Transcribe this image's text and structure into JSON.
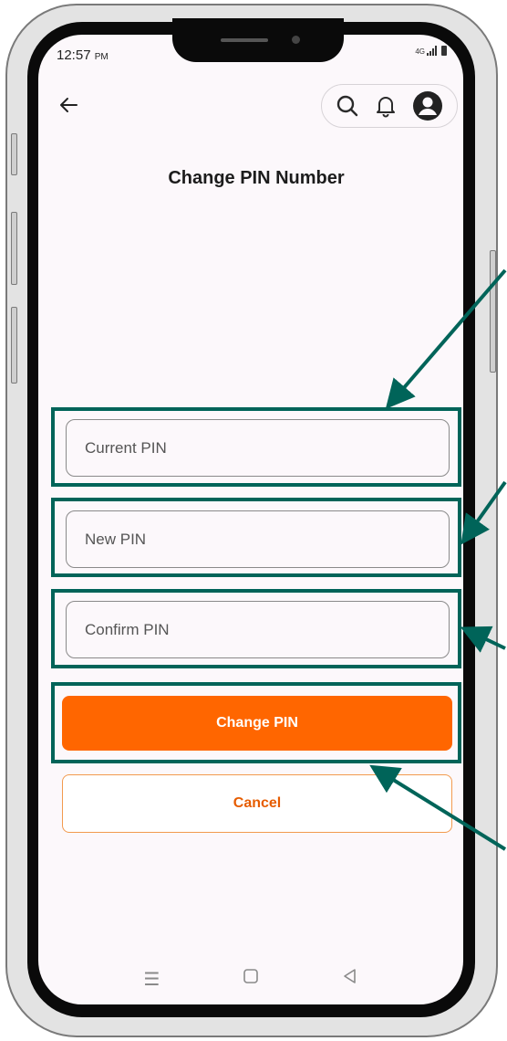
{
  "status": {
    "time": "12:57",
    "ampm": "PM",
    "network": "4G"
  },
  "header": {
    "back_icon": "back-arrow-icon",
    "icons": [
      "search-icon",
      "bell-icon",
      "account-icon"
    ]
  },
  "page": {
    "title": "Change PIN Number"
  },
  "form": {
    "current_pin": {
      "placeholder": "Current PIN",
      "value": ""
    },
    "new_pin": {
      "placeholder": "New PIN",
      "value": ""
    },
    "confirm_pin": {
      "placeholder": "Confirm PIN",
      "value": ""
    }
  },
  "actions": {
    "primary_label": "Change PIN",
    "secondary_label": "Cancel"
  },
  "nav": {
    "icons": [
      "menu-icon",
      "home-icon",
      "back-icon"
    ]
  },
  "colors": {
    "accent": "#FF6600",
    "highlight": "#006459",
    "background": "#FCF8FB",
    "cancel_text": "#E65C00"
  }
}
